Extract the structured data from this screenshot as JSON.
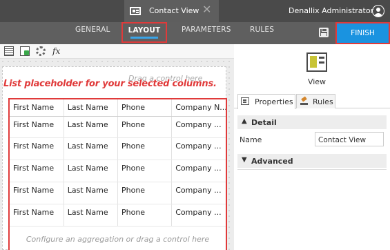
{
  "topbar": {
    "tab_title": "Contact View",
    "tab_close": "✕",
    "user_name": "Denallix Administrator"
  },
  "nav": {
    "general": "GENERAL",
    "layout": "LAYOUT",
    "parameters": "PARAMETERS",
    "rules": "RULES",
    "finish": "FINISH",
    "active": "LAYOUT",
    "accent_color": "#1a93e0",
    "highlight_color": "#e03a3a"
  },
  "toolbar": {
    "icons": [
      "list-icon",
      "form-icon",
      "gear-icon",
      "fx-icon"
    ],
    "fx_label": "fx"
  },
  "canvas": {
    "drag_hint_top": "Drag a control here",
    "annotation": "List placeholder for your selected columns.",
    "footer_hint": "Configure an aggregation or drag a control here",
    "columns": [
      "First Name",
      "Last Name",
      "Phone",
      "Company N..."
    ],
    "rows": [
      [
        "First Name",
        "Last Name",
        "Phone",
        "Company ..."
      ],
      [
        "First Name",
        "Last Name",
        "Phone",
        "Company ..."
      ],
      [
        "First Name",
        "Last Name",
        "Phone",
        "Company ..."
      ],
      [
        "First Name",
        "Last Name",
        "Phone",
        "Company ..."
      ],
      [
        "First Name",
        "Last Name",
        "Phone",
        "Company ..."
      ]
    ]
  },
  "panel": {
    "view_label": "View",
    "tabs": [
      {
        "label": "Properties"
      },
      {
        "label": "Rules"
      }
    ],
    "detail_header": "Detail",
    "name_label": "Name",
    "name_value": "Contact View",
    "advanced_header": "Advanced"
  }
}
